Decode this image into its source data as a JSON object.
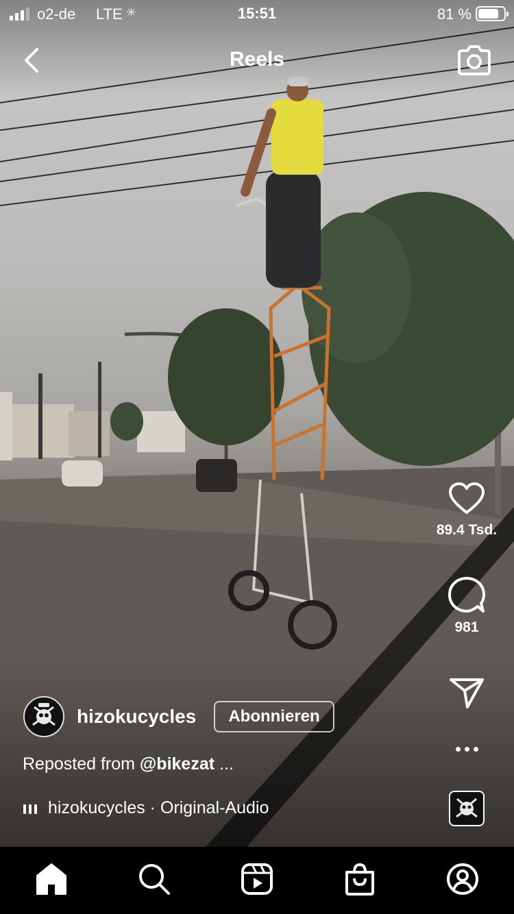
{
  "status_bar": {
    "carrier": "o2-de",
    "network": "LTE",
    "time": "15:51",
    "battery_percent": "81 %",
    "battery_level": 0.81,
    "signal_bars": 3
  },
  "header": {
    "title": "Reels",
    "back_icon": "chevron-left-icon",
    "camera_icon": "camera-icon"
  },
  "actions": {
    "like_count": "89.4 Tsd.",
    "comment_count": "981",
    "like_icon": "heart-icon",
    "comment_icon": "comment-bubble-icon",
    "share_icon": "paper-plane-icon",
    "more_icon": "more-dots-icon"
  },
  "post": {
    "username": "hizokucycles",
    "follow_label": "Abonnieren",
    "caption_prefix": "Reposted from ",
    "caption_mention": "@bikezat",
    "caption_more": " ...",
    "audio_label": "hizokucycles · Original-Audio"
  },
  "tabs": [
    {
      "name": "home",
      "icon": "home-icon",
      "active": true
    },
    {
      "name": "search",
      "icon": "search-icon",
      "active": false
    },
    {
      "name": "reels",
      "icon": "reels-icon",
      "active": false
    },
    {
      "name": "shop",
      "icon": "shopping-bag-icon",
      "active": false
    },
    {
      "name": "profile",
      "icon": "profile-icon",
      "active": false
    }
  ],
  "colors": {
    "text": "#ffffff",
    "tab_bar_background": "#000000"
  }
}
